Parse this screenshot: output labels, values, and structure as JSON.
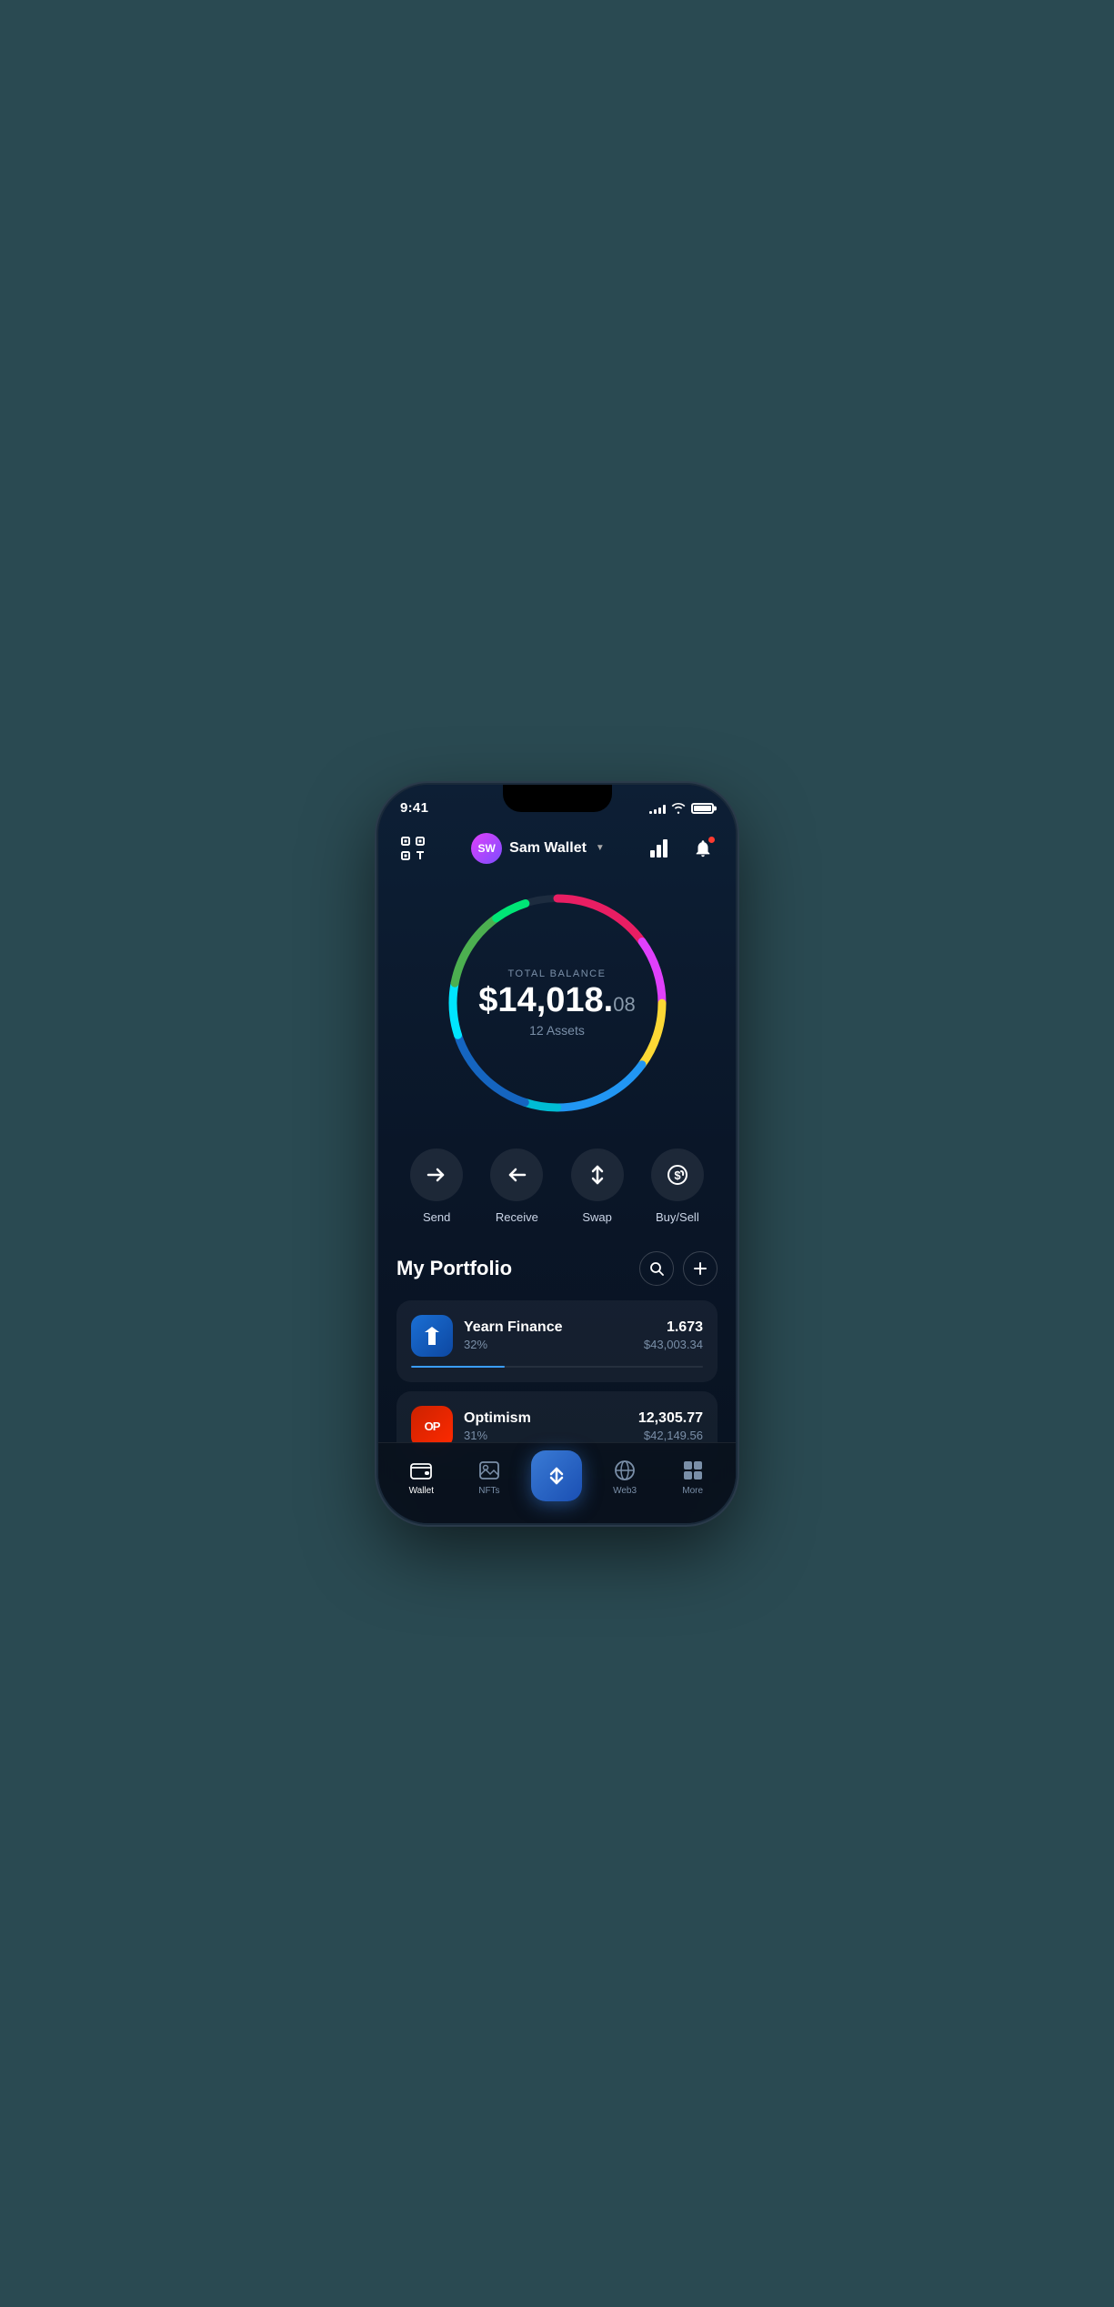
{
  "statusBar": {
    "time": "9:41",
    "signals": [
      3,
      5,
      7,
      10
    ],
    "batteryFull": true
  },
  "header": {
    "scanLabel": "scan",
    "userInitials": "SW",
    "userName": "Sam Wallet",
    "chartLabel": "chart",
    "bellLabel": "notifications"
  },
  "balance": {
    "label": "TOTAL BALANCE",
    "mainAmount": "$14,018.",
    "cents": "08",
    "assets": "12 Assets"
  },
  "actions": [
    {
      "id": "send",
      "label": "Send",
      "icon": "→"
    },
    {
      "id": "receive",
      "label": "Receive",
      "icon": "←"
    },
    {
      "id": "swap",
      "label": "Swap",
      "icon": "⇅"
    },
    {
      "id": "buysell",
      "label": "Buy/Sell",
      "icon": "$"
    }
  ],
  "portfolio": {
    "title": "My Portfolio",
    "searchLabel": "search",
    "addLabel": "add",
    "assets": [
      {
        "name": "Yearn Finance",
        "percent": "32%",
        "amount": "1.673",
        "usd": "$43,003.34",
        "barWidth": "32%",
        "barColor": "#3a9dff",
        "logoColor": "#1a6fd4",
        "logoText": "Y"
      },
      {
        "name": "Optimism",
        "percent": "31%",
        "amount": "12,305.77",
        "usd": "$42,149.56",
        "barWidth": "31%",
        "barColor": "#ff3b30",
        "logoColor": "#cc2200",
        "logoText": "OP"
      }
    ]
  },
  "bottomNav": [
    {
      "id": "wallet",
      "label": "Wallet",
      "active": true
    },
    {
      "id": "nfts",
      "label": "NFTs",
      "active": false
    },
    {
      "id": "center",
      "label": "",
      "active": false
    },
    {
      "id": "web3",
      "label": "Web3",
      "active": false
    },
    {
      "id": "more",
      "label": "More",
      "active": false
    }
  ],
  "ring": {
    "segments": [
      {
        "color": "#e91e63",
        "offset": 0,
        "length": 15
      },
      {
        "color": "#ff5722",
        "offset": 15,
        "length": 5
      },
      {
        "color": "#e040fb",
        "offset": 20,
        "length": 10
      },
      {
        "color": "#fdd835",
        "offset": 30,
        "length": 10
      },
      {
        "color": "#2196f3",
        "offset": 40,
        "length": 20
      },
      {
        "color": "#00bcd4",
        "offset": 60,
        "length": 5
      },
      {
        "color": "#1976d2",
        "offset": 65,
        "length": 15
      },
      {
        "color": "#00e5ff",
        "offset": 80,
        "length": 8
      },
      {
        "color": "#4caf50",
        "offset": 88,
        "length": 8
      },
      {
        "color": "#00e676",
        "offset": 96,
        "length": 4
      }
    ]
  }
}
